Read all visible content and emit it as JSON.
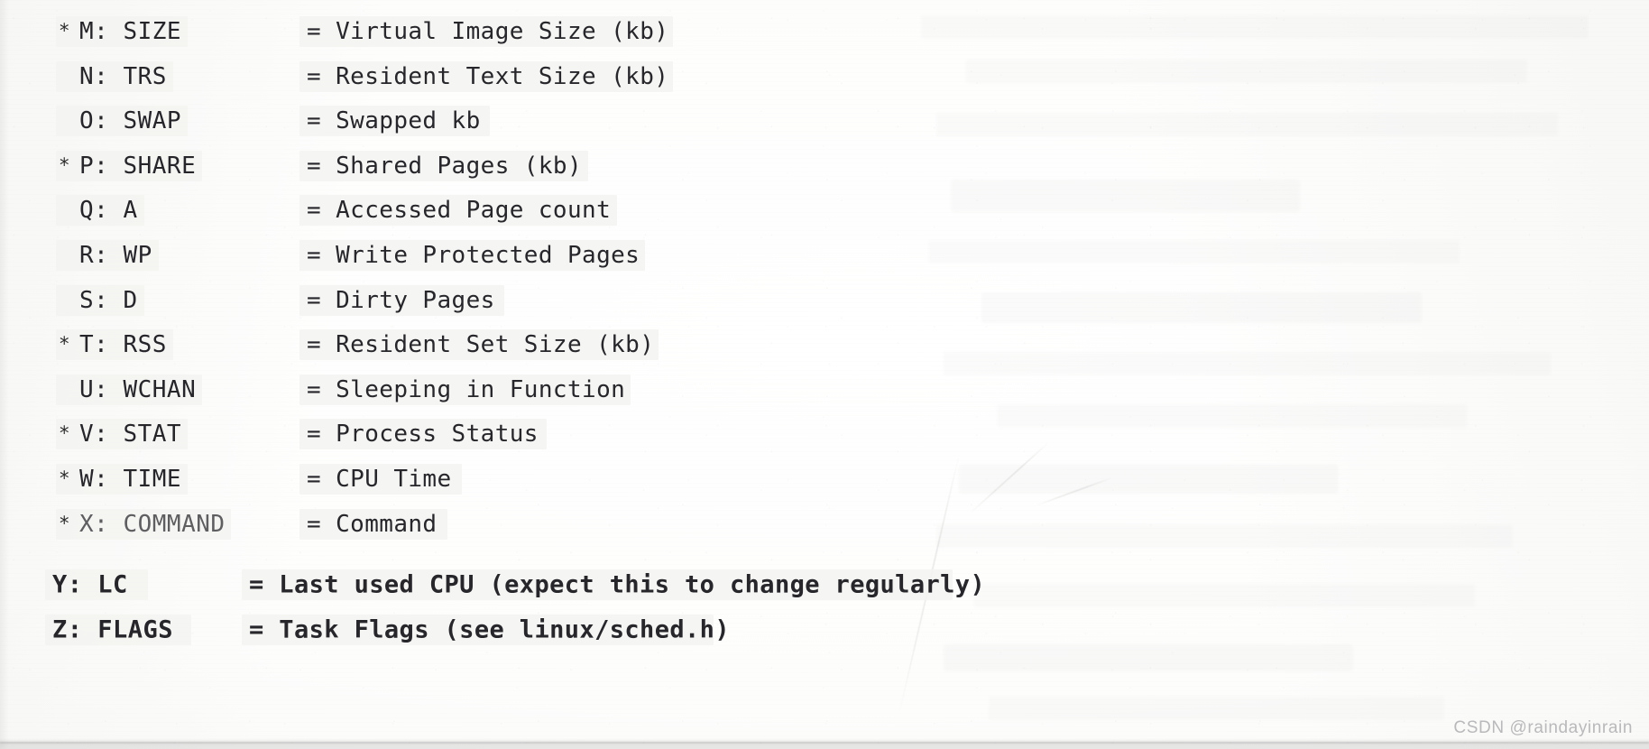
{
  "page": {
    "kind": "scanned-book-page",
    "watermark": "CSDN @raindayinrain",
    "paper_color": "#fdfdfc",
    "ink_color": "#25252a"
  },
  "legend": {
    "asterisk_marker": "*",
    "separator": "="
  },
  "fields": [
    {
      "starred": true,
      "code": "M: SIZE",
      "desc": "= Virtual Image Size (kb)",
      "shifted": false,
      "fade": ""
    },
    {
      "starred": false,
      "code": "N: TRS",
      "desc": "= Resident Text Size (kb)",
      "shifted": false,
      "fade": ""
    },
    {
      "starred": false,
      "code": "O: SWAP",
      "desc": "= Swapped kb",
      "shifted": false,
      "fade": ""
    },
    {
      "starred": true,
      "code": "P: SHARE",
      "desc": "= Shared Pages (kb)",
      "shifted": false,
      "fade": ""
    },
    {
      "starred": false,
      "code": "Q: A",
      "desc": "= Accessed Page count",
      "shifted": false,
      "fade": ""
    },
    {
      "starred": false,
      "code": "R: WP",
      "desc": "= Write Protected Pages",
      "shifted": false,
      "fade": ""
    },
    {
      "starred": false,
      "code": "S: D",
      "desc": "= Dirty Pages",
      "shifted": false,
      "fade": ""
    },
    {
      "starred": true,
      "code": "T: RSS",
      "desc": "= Resident Set Size (kb)",
      "shifted": false,
      "fade": ""
    },
    {
      "starred": false,
      "code": "U: WCHAN",
      "desc": "= Sleeping in Function",
      "shifted": false,
      "fade": ""
    },
    {
      "starred": true,
      "code": "V: STAT",
      "desc": "= Process Status",
      "shifted": false,
      "fade": ""
    },
    {
      "starred": true,
      "code": "W: TIME",
      "desc": "= CPU Time",
      "shifted": false,
      "fade": ""
    },
    {
      "starred": true,
      "code": "X: COMMAND",
      "desc": "= Command",
      "shifted": false,
      "fade": "faded"
    },
    {
      "starred": false,
      "code": "Y: LC",
      "desc": "= Last used CPU (expect this to change regularly)",
      "shifted": true,
      "fade": ""
    },
    {
      "starred": false,
      "code": "Z: FLAGS",
      "desc": "= Task Flags (see linux/sched.h)",
      "shifted": true,
      "fade": ""
    }
  ]
}
